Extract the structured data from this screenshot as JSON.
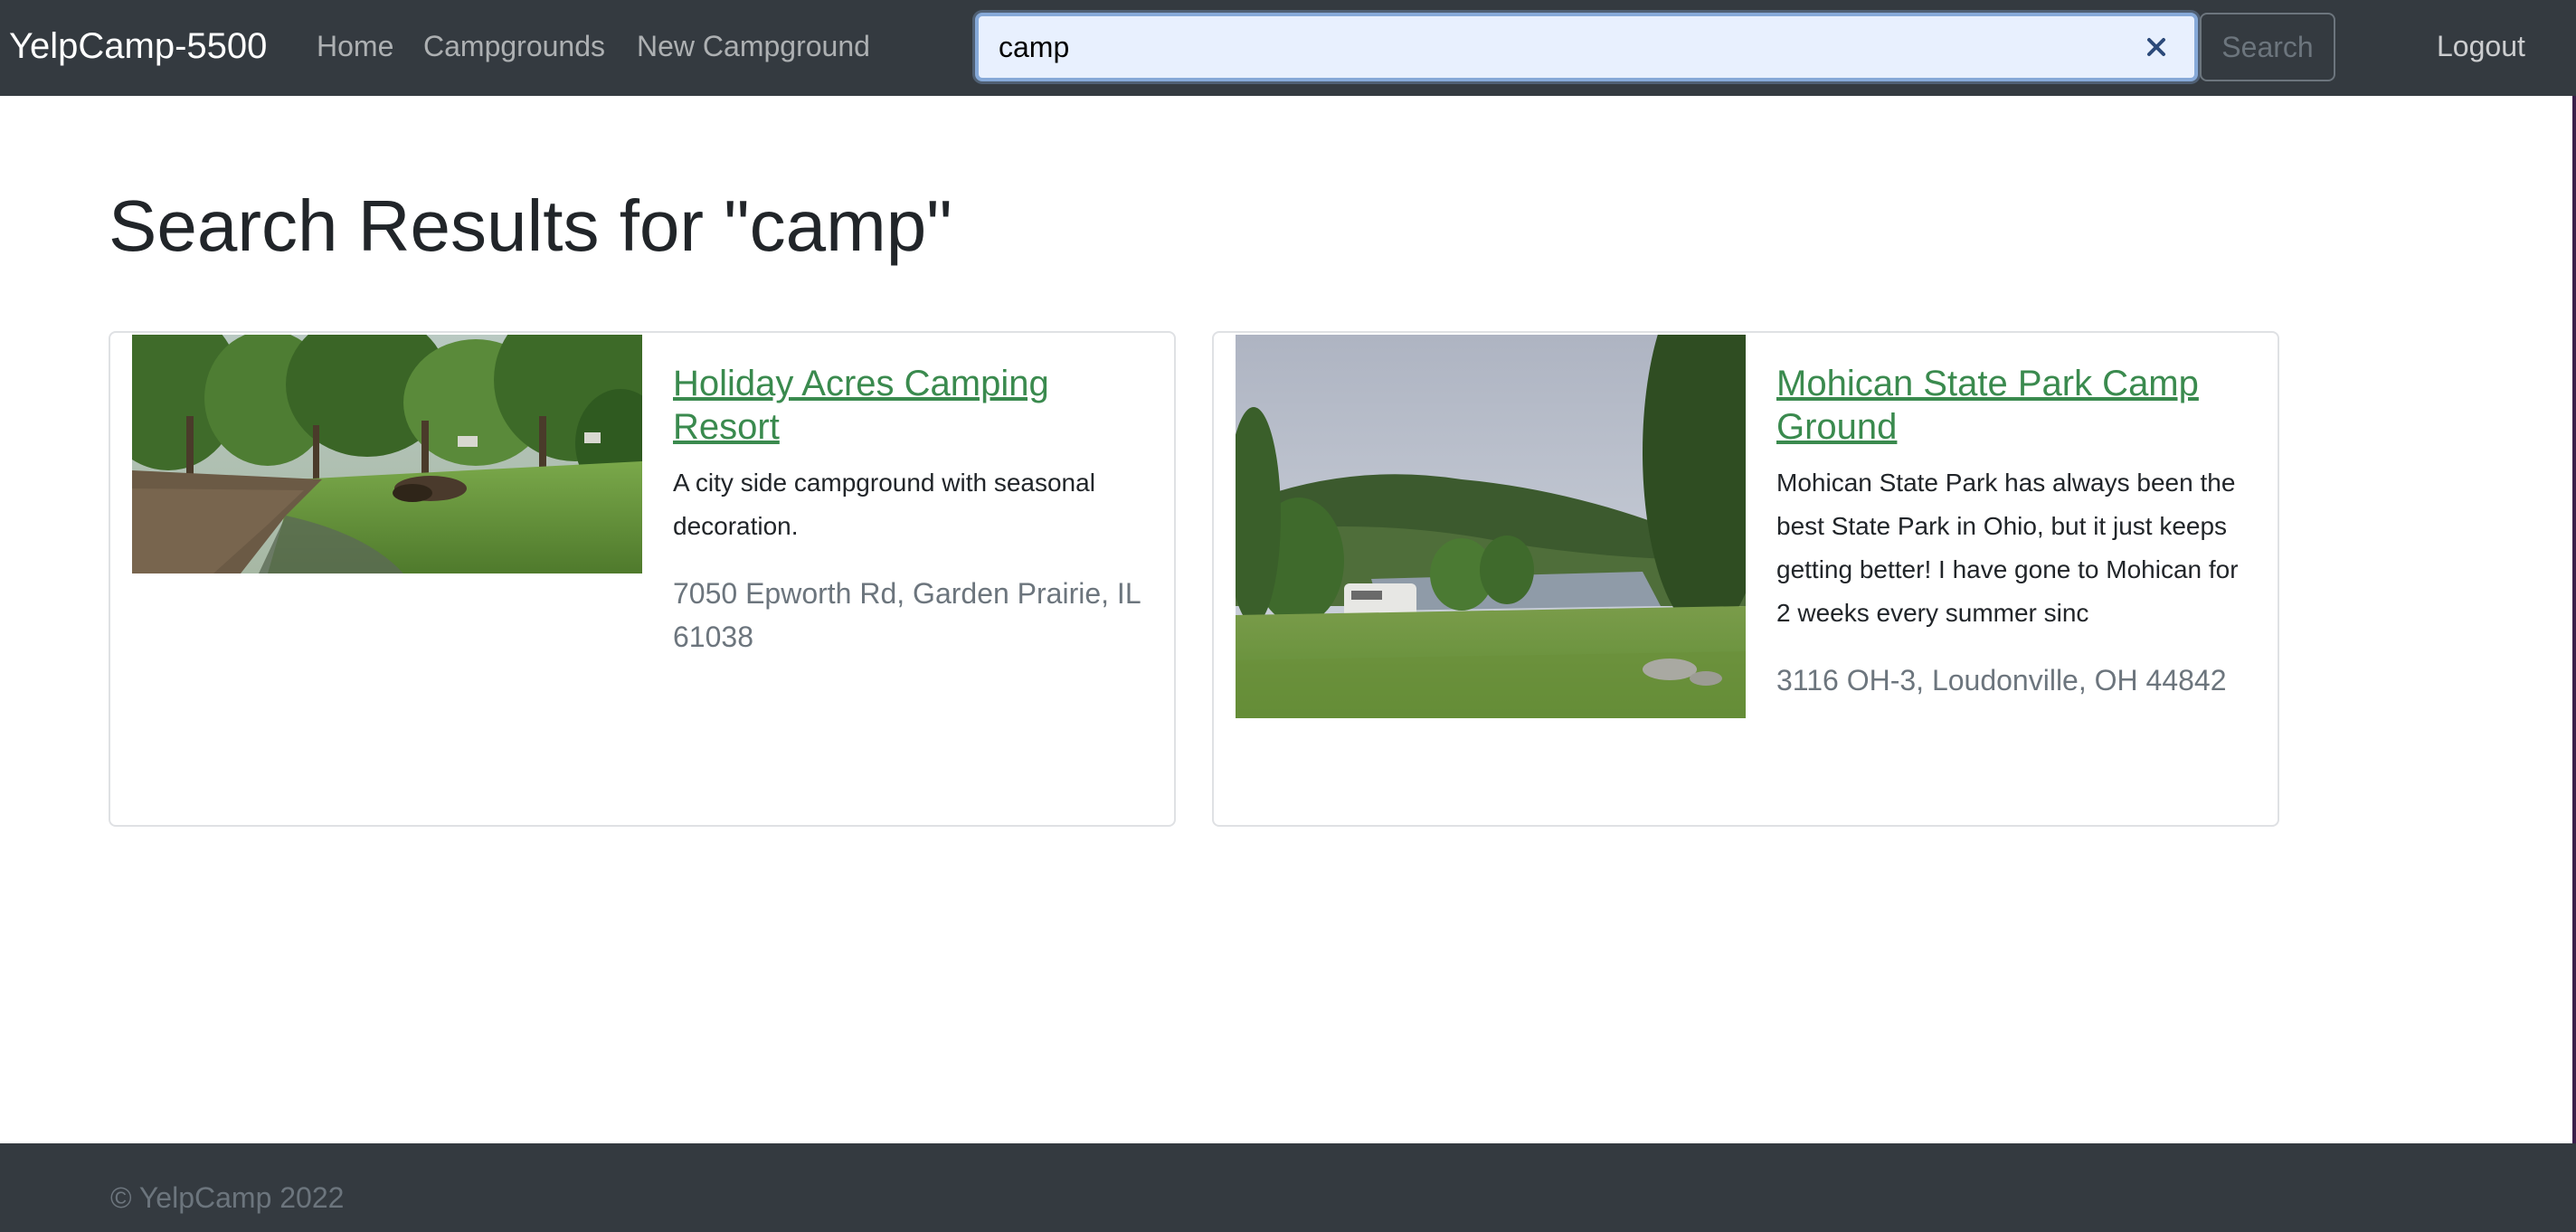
{
  "navbar": {
    "brand": "YelpCamp-5500",
    "links": [
      "Home",
      "Campgrounds",
      "New Campground"
    ],
    "search": {
      "value": "camp",
      "placeholder": "Search",
      "clear_icon": "close-icon",
      "button_label": "Search"
    },
    "logout_label": "Logout"
  },
  "main": {
    "title": "Search Results for \"camp\"",
    "results": [
      {
        "name": "Holiday Acres Camping Resort",
        "description": "A city side campground with seasonal decoration.",
        "address": "7050 Epworth Rd, Garden Prairie, IL 61038"
      },
      {
        "name": "Mohican State Park Camp Ground",
        "description": "Mohican State Park has always been the best State Park in Ohio, but it just keeps getting better! I have gone to Mohican for 2 weeks every summer sinc",
        "address": "3116 OH-3, Loudonville, OH 44842"
      }
    ]
  },
  "footer": {
    "text": "© YelpCamp 2022"
  },
  "colors": {
    "navbar_bg": "#343a40",
    "link_green": "#3a8a4e",
    "muted": "#6c757d"
  }
}
